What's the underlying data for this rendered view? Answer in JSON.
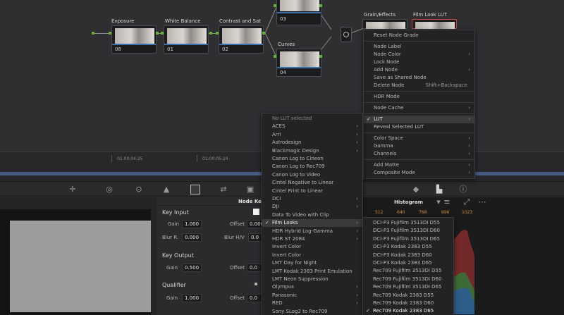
{
  "nodes": {
    "titles": [
      "Exposure",
      "White Balance",
      "Contrast and Sat",
      "Curves",
      "Grain/Effects",
      "Film Look LUT"
    ],
    "numbers": [
      "08",
      "01",
      "02",
      "03",
      "04"
    ]
  },
  "timeline": {
    "tc1": "01:00:04:25",
    "tc2": "01:00:05:24"
  },
  "key_panel": {
    "header": "Node Ke",
    "key_input": "Key Input",
    "gain_label": "Gain",
    "gain_value": "1.000",
    "offset_label": "Offset",
    "offset_value": "0.000",
    "blur_r_label": "Blur R.",
    "blur_r_value": "0.000",
    "blur_hv_label": "Blur H/V",
    "blur_hv_value": "0.0",
    "key_output": "Key Output",
    "out_gain_label": "Gain",
    "out_gain_value": "0.500",
    "out_offset_label": "Offset",
    "out_offset_value": "0.0",
    "qualifier": "Qualifier",
    "q_gain_label": "Gain",
    "q_gain_value": "1.000",
    "q_offset_label": "Offset",
    "q_offset_value": "0.0"
  },
  "histogram": {
    "title": "Histogram",
    "ticks": [
      "512",
      "640",
      "768",
      "896",
      "1023"
    ]
  },
  "node_context_menu": {
    "items": [
      {
        "label": "Reset Node Grade"
      },
      {
        "label": "Node Label"
      },
      {
        "label": "Node Color",
        "submenu": true
      },
      {
        "label": "Lock Node"
      },
      {
        "label": "Add Node",
        "submenu": true
      },
      {
        "label": "Save as Shared Node"
      },
      {
        "label": "Delete Node",
        "shortcut": "Shift+Backspace"
      },
      {
        "label": "HDR Mode"
      },
      {
        "label": "Node Cache",
        "submenu": true
      },
      {
        "label": "LUT",
        "submenu": true,
        "checked": true,
        "highlighted": true
      },
      {
        "label": "Reveal Selected LUT"
      },
      {
        "label": "Color Space",
        "submenu": true
      },
      {
        "label": "Gamma",
        "submenu": true
      },
      {
        "label": "Channels",
        "submenu": true
      },
      {
        "label": "Add Matte",
        "submenu": true
      },
      {
        "label": "Composite Mode",
        "submenu": true
      }
    ]
  },
  "lut_menu": {
    "items": [
      {
        "label": "No LUT selected"
      },
      {
        "label": "ACES",
        "submenu": true
      },
      {
        "label": "Arri",
        "submenu": true
      },
      {
        "label": "Astrodesign",
        "submenu": true
      },
      {
        "label": "Blackmagic Design",
        "submenu": true
      },
      {
        "label": "Canon Log to Cineon"
      },
      {
        "label": "Canon Log to Rec709"
      },
      {
        "label": "Canon Log to Video"
      },
      {
        "label": "Cintel Negative to Linear"
      },
      {
        "label": "Cintel Print to Linear"
      },
      {
        "label": "DCI",
        "submenu": true
      },
      {
        "label": "DJI",
        "submenu": true
      },
      {
        "label": "Data To Video with Clip"
      },
      {
        "label": "Film Looks",
        "submenu": true,
        "checked": true,
        "highlighted": true
      },
      {
        "label": "HDR Hybrid Log-Gamma",
        "submenu": true
      },
      {
        "label": "HDR ST 2084",
        "submenu": true
      },
      {
        "label": "Invert Color"
      },
      {
        "label": "Invert Color"
      },
      {
        "label": "LMT Day for Night"
      },
      {
        "label": "LMT Kodak 2383 Print Emulation"
      },
      {
        "label": "LMT Neon Suppression"
      },
      {
        "label": "Olympus",
        "submenu": true
      },
      {
        "label": "Panasonic",
        "submenu": true
      },
      {
        "label": "RED",
        "submenu": true
      },
      {
        "label": "Sony SLog2 to Rec709"
      }
    ]
  },
  "film_looks_menu": {
    "items": [
      {
        "label": "DCI-P3 Fujifilm 3513DI D55"
      },
      {
        "label": "DCI-P3 Fujifilm 3513DI D60"
      },
      {
        "label": "DCI-P3 Fujifilm 3513DI D65"
      },
      {
        "label": "DCI-P3 Kodak 2383 D55"
      },
      {
        "label": "DCI-P3 Kodak 2383 D60"
      },
      {
        "label": "DCI-P3 Kodak 2383 D65"
      },
      {
        "label": "Rec709 Fujifilm 3513DI D55"
      },
      {
        "label": "Rec709 Fujifilm 3513DI D60"
      },
      {
        "label": "Rec709 Fujifilm 3513DI D65"
      },
      {
        "label": "Rec709 Kodak 2383 D55"
      },
      {
        "label": "Rec709 Kodak 2383 D60"
      },
      {
        "label": "Rec709 Kodak 2383 D65",
        "checked": true
      }
    ]
  },
  "colors": {
    "accent_blue": "#3a78c9",
    "port_green": "#62b13e",
    "hist_orange": "#d98b3a"
  }
}
